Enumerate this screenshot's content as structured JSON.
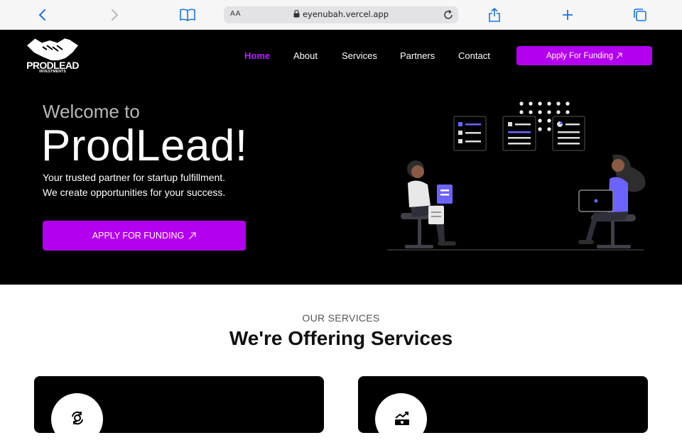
{
  "browser": {
    "reader_label": "AA",
    "url": "eyenubah.vercel.app"
  },
  "logo": {
    "name": "PRODLEAD",
    "subtitle": "INVESTMENTS"
  },
  "nav": {
    "items": [
      {
        "label": "Home",
        "active": true
      },
      {
        "label": "About"
      },
      {
        "label": "Services"
      },
      {
        "label": "Partners"
      },
      {
        "label": "Contact"
      }
    ],
    "cta_label": "Apply For Funding"
  },
  "hero": {
    "welcome": "Welcome to",
    "brand": "ProdLead!",
    "tagline_line1": "Your trusted partner for startup fulfillment.",
    "tagline_line2": "We create opportunities for your success.",
    "cta_label": "APPLY FOR FUNDING"
  },
  "services": {
    "eyebrow": "OUR SERVICES",
    "title": "We're Offering Services"
  },
  "colors": {
    "accent": "#b400f0",
    "nav_active": "#b41fff",
    "hero_bg": "#000000",
    "illustration_accent": "#6c63ff"
  }
}
